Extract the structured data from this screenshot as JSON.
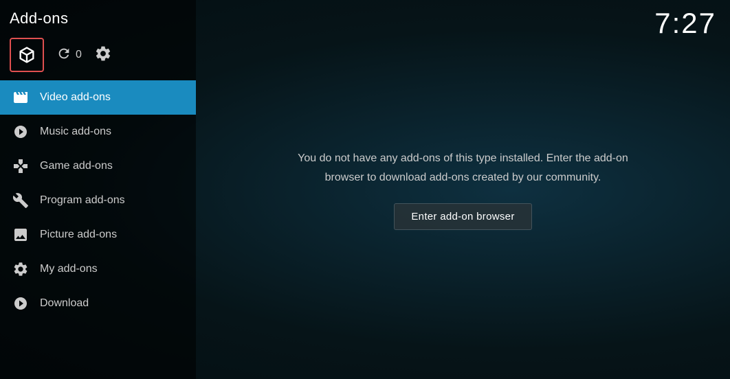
{
  "header": {
    "title": "Add-ons",
    "time": "7:27"
  },
  "iconBar": {
    "refreshCount": "0"
  },
  "nav": {
    "items": [
      {
        "id": "video",
        "label": "Video add-ons",
        "active": true,
        "icon": "video"
      },
      {
        "id": "music",
        "label": "Music add-ons",
        "active": false,
        "icon": "music"
      },
      {
        "id": "game",
        "label": "Game add-ons",
        "active": false,
        "icon": "game"
      },
      {
        "id": "program",
        "label": "Program add-ons",
        "active": false,
        "icon": "program"
      },
      {
        "id": "picture",
        "label": "Picture add-ons",
        "active": false,
        "icon": "picture"
      },
      {
        "id": "myaddon",
        "label": "My add-ons",
        "active": false,
        "icon": "myaddon"
      },
      {
        "id": "download",
        "label": "Download",
        "active": false,
        "icon": "download"
      }
    ]
  },
  "main": {
    "emptyMessage": "You do not have any add-ons of this type installed. Enter the add-on browser to download add-ons created by our community.",
    "browserButtonLabel": "Enter add-on browser"
  }
}
